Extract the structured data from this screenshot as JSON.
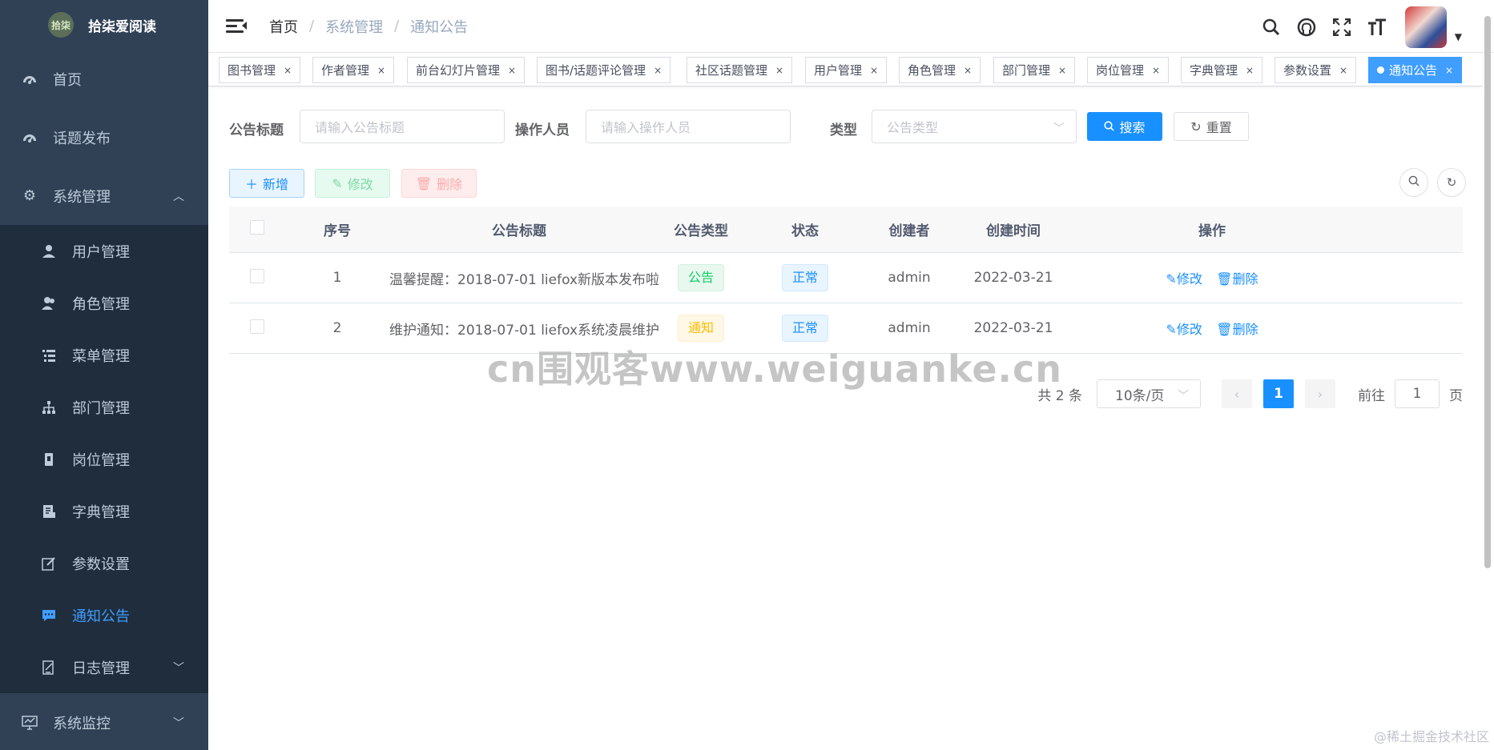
{
  "app": {
    "logo_text": "拾柒爱阅读",
    "logo_mark": "拾柒"
  },
  "sidebar": {
    "top_items": [
      {
        "label": "首页",
        "icon": "dashboard-icon"
      },
      {
        "label": "话题发布",
        "icon": "dashboard-icon"
      }
    ],
    "system": {
      "label": "系统管理",
      "icon": "gear-icon",
      "expanded": true
    },
    "sub_items": [
      {
        "label": "用户管理",
        "icon": "user-icon"
      },
      {
        "label": "角色管理",
        "icon": "peoples-icon"
      },
      {
        "label": "菜单管理",
        "icon": "tree-table-icon"
      },
      {
        "label": "部门管理",
        "icon": "tree-icon"
      },
      {
        "label": "岗位管理",
        "icon": "post-icon"
      },
      {
        "label": "字典管理",
        "icon": "dict-icon"
      },
      {
        "label": "参数设置",
        "icon": "edit-icon"
      },
      {
        "label": "通知公告",
        "icon": "message-icon",
        "active": true
      },
      {
        "label": "日志管理",
        "icon": "log-icon"
      }
    ],
    "monitor": {
      "label": "系统监控",
      "icon": "monitor-icon"
    }
  },
  "navbar": {
    "breadcrumb": [
      "首页",
      "系统管理",
      "通知公告"
    ],
    "icons": [
      "search-icon",
      "github-icon",
      "fullscreen-icon",
      "font-size-icon"
    ]
  },
  "tags": [
    "图书管理",
    "作者管理",
    "前台幻灯片管理",
    "图书/话题评论管理",
    "社区话题管理",
    "用户管理",
    "角色管理",
    "部门管理",
    "岗位管理",
    "字典管理",
    "参数设置",
    "通知公告"
  ],
  "active_tag": "通知公告",
  "search": {
    "title_label": "公告标题",
    "title_placeholder": "请输入公告标题",
    "operator_label": "操作人员",
    "operator_placeholder": "请输入操作人员",
    "type_label": "类型",
    "type_placeholder": "公告类型",
    "search_button": "搜索",
    "reset_button": "重置"
  },
  "toolbar": {
    "add": "新增",
    "edit": "修改",
    "delete": "删除"
  },
  "table": {
    "headers": [
      "序号",
      "公告标题",
      "公告类型",
      "状态",
      "创建者",
      "创建时间",
      "操作"
    ],
    "rows": [
      {
        "index": "1",
        "title": "温馨提醒：2018-07-01 liefox新版本发布啦",
        "type": "公告",
        "type_style": "success",
        "status": "正常",
        "creator": "admin",
        "created": "2022-03-21"
      },
      {
        "index": "2",
        "title": "维护通知：2018-07-01 liefox系统凌晨维护",
        "type": "通知",
        "type_style": "warning",
        "status": "正常",
        "creator": "admin",
        "created": "2022-03-21"
      }
    ],
    "op_edit": "修改",
    "op_delete": "删除"
  },
  "pagination": {
    "total": "共 2 条",
    "page_size": "10条/页",
    "current": "1",
    "goto_label": "前往",
    "goto_value": "1",
    "page_suffix": "页"
  },
  "watermark": "cn围观客www.weiguanke.cn",
  "footer_credit": "@稀土掘金技术社区",
  "colors": {
    "sidebar_bg": "#304156",
    "submenu_bg": "#1f2d3d",
    "primary": "#1890ff",
    "active_menu": "#409eff"
  }
}
